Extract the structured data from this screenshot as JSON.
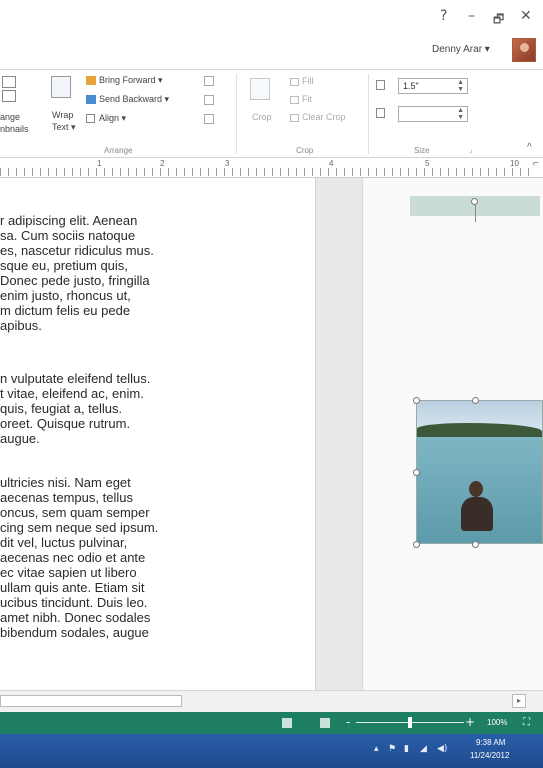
{
  "window": {
    "help": "?",
    "minimize": "–",
    "restore": "🗗",
    "close": "✕",
    "user_name": "Denny Arar ▾"
  },
  "ribbon": {
    "arrange_thumbnails_line1": "ange",
    "arrange_thumbnails_line2": "nbnails",
    "wrap_text_line1": "Wrap",
    "wrap_text_line2": "Text ▾",
    "bring_forward": "Bring Forward ▾",
    "send_backward": "Send Backward ▾",
    "align": "Align ▾",
    "arrange_group": "Arrange",
    "crop": "Crop",
    "fill": "Fill",
    "fit": "Fit",
    "clear_crop": "Clear Crop",
    "crop_group": "Crop",
    "height_value": "1.5\"",
    "width_value": "",
    "size_group": "Size",
    "collapse": "^"
  },
  "ruler": {
    "numbers": [
      "1",
      "2",
      "3",
      "4",
      "5",
      "10"
    ]
  },
  "document": {
    "paragraphs": [
      "r adipiscing elit. Aenean\nsa. Cum sociis natoque\nes, nascetur ridiculus mus.\nsque eu, pretium quis,\nDonec pede justo, fringilla\nenim justo, rhoncus ut,\nm dictum felis eu pede\napibus.",
      "n vulputate eleifend tellus.\nt vitae, eleifend ac, enim.\nquis, feugiat a, tellus.\noreet. Quisque rutrum.\naugue.",
      "ultricies nisi. Nam eget\naecenas tempus, tellus\noncus, sem quam semper\ncing sem neque sed ipsum.\ndit vel, luctus pulvinar,\naecenas nec odio et ante\nec vitae sapien ut libero\nullam quis ante. Etiam sit\nucibus tincidunt. Duis leo.\namet nibh. Donec sodales\nbibendum sodales, augue"
    ]
  },
  "statusbar": {
    "zoom_minus": "-",
    "zoom_plus": "+",
    "zoom_level": "100%"
  },
  "taskbar": {
    "time": "9:38 AM",
    "date": "11/24/2012"
  },
  "colors": {
    "status_green": "#1d7e61",
    "taskbar_blue": "#1f4b8e"
  }
}
